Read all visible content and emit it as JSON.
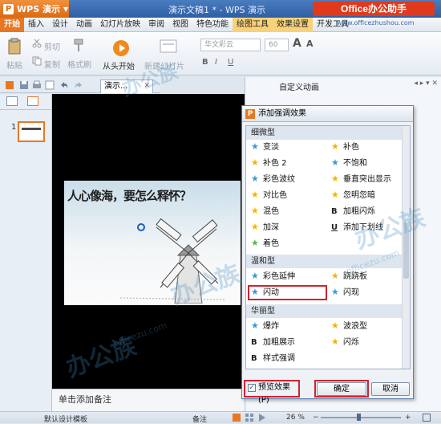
{
  "titlebar": {
    "app_name": "WPS 演示",
    "doc_title": "演示文稿1 * - WPS 演示",
    "brand": "Office办公助手",
    "brand_url": "www.officezhushou.com"
  },
  "menu": [
    "开始",
    "插入",
    "设计",
    "动画",
    "幻灯片放映",
    "审阅",
    "视图",
    "特色功能",
    "绘图工具",
    "效果设置",
    "开发工具"
  ],
  "ribbon": {
    "cut": "剪切",
    "paste": "粘贴",
    "copy": "复制",
    "format_painter": "格式刷",
    "from_start": "从头开始",
    "new_slide": "新建幻灯片",
    "font_placeholder": "华文彩云",
    "font_size": "60",
    "font_size_up": "A",
    "font_size_down": "A"
  },
  "doc_tab": {
    "label": "演示..."
  },
  "slide_panel": {
    "slide_number": "1"
  },
  "slide": {
    "caption": "人心像海，要怎么释怀？"
  },
  "notes": {
    "placeholder": "单击添加备注"
  },
  "task_pane": {
    "title": "自定义动画",
    "controls": "◂ ▸ ▾ ✕"
  },
  "dialog": {
    "title": "添加强调效果",
    "sections": [
      {
        "name": "细微型",
        "left": [
          "变淡",
          "补色 2",
          "彩色波纹",
          "对比色",
          "混色",
          "加深",
          "着色"
        ],
        "right": [
          "补色",
          "不饱和",
          "垂直突出显示",
          "忽明忽暗",
          "加粗闪烁",
          "添加下划线"
        ]
      },
      {
        "name": "温和型",
        "left": [
          "彩色延伸",
          "闪动"
        ],
        "right": [
          "跷跷板",
          "闪现"
        ]
      },
      {
        "name": "华丽型",
        "left": [
          "爆炸",
          "加粗展示",
          "样式强调"
        ],
        "right": [
          "波浪型",
          "闪烁"
        ]
      }
    ],
    "preview_label": "预览效果(P)",
    "preview_checked": "✓",
    "ok": "确定",
    "cancel": "取消"
  },
  "statusbar": {
    "template": "默认设计模板",
    "notes": "备注",
    "zoom": "26 %",
    "minus": "−",
    "plus": "+"
  },
  "colors": {
    "accent_orange": "#e87722",
    "highlight_red": "#d3222e",
    "title_blue": "#2f5fa3"
  }
}
